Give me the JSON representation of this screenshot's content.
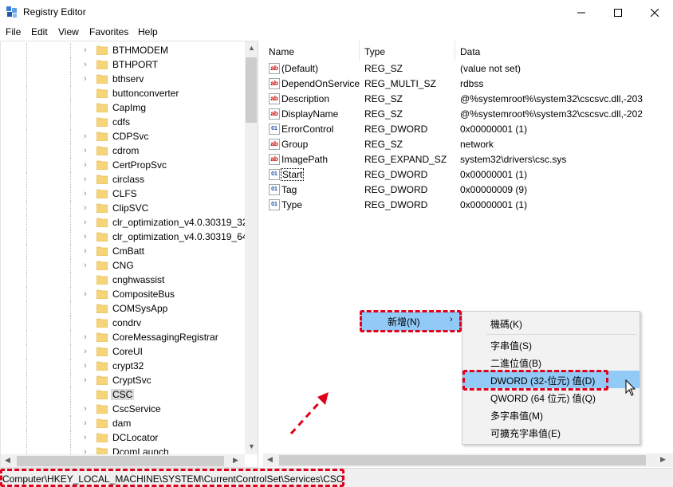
{
  "window": {
    "title": "Registry Editor",
    "controls": [
      "minimize",
      "maximize",
      "close"
    ]
  },
  "menu": [
    "File",
    "Edit",
    "View",
    "Favorites",
    "Help"
  ],
  "tree": {
    "items": [
      {
        "label": "BTHMODEM",
        "expandable": true
      },
      {
        "label": "BTHPORT",
        "expandable": true
      },
      {
        "label": "bthserv",
        "expandable": true
      },
      {
        "label": "buttonconverter",
        "expandable": false
      },
      {
        "label": "CapImg",
        "expandable": false
      },
      {
        "label": "cdfs",
        "expandable": false
      },
      {
        "label": "CDPSvc",
        "expandable": true
      },
      {
        "label": "cdrom",
        "expandable": true
      },
      {
        "label": "CertPropSvc",
        "expandable": true
      },
      {
        "label": "circlass",
        "expandable": true
      },
      {
        "label": "CLFS",
        "expandable": true
      },
      {
        "label": "ClipSVC",
        "expandable": true
      },
      {
        "label": "clr_optimization_v4.0.30319_32",
        "expandable": true
      },
      {
        "label": "clr_optimization_v4.0.30319_64",
        "expandable": true
      },
      {
        "label": "CmBatt",
        "expandable": true
      },
      {
        "label": "CNG",
        "expandable": true
      },
      {
        "label": "cnghwassist",
        "expandable": false
      },
      {
        "label": "CompositeBus",
        "expandable": true
      },
      {
        "label": "COMSysApp",
        "expandable": false
      },
      {
        "label": "condrv",
        "expandable": false
      },
      {
        "label": "CoreMessagingRegistrar",
        "expandable": true
      },
      {
        "label": "CoreUI",
        "expandable": true
      },
      {
        "label": "crypt32",
        "expandable": true
      },
      {
        "label": "CryptSvc",
        "expandable": true
      },
      {
        "label": "CSC",
        "expandable": false,
        "selected": true
      },
      {
        "label": "CscService",
        "expandable": true
      },
      {
        "label": "dam",
        "expandable": true
      },
      {
        "label": "DCLocator",
        "expandable": true
      },
      {
        "label": "DcomLaunch",
        "expandable": true
      }
    ]
  },
  "columns": {
    "name": "Name",
    "type": "Type",
    "data": "Data"
  },
  "values": [
    {
      "icon": "string-value-icon",
      "glyph": "ab",
      "name": "(Default)",
      "type": "REG_SZ",
      "data": "(value not set)"
    },
    {
      "icon": "string-value-icon",
      "glyph": "ab",
      "name": "DependOnService",
      "type": "REG_MULTI_SZ",
      "data": "rdbss"
    },
    {
      "icon": "string-value-icon",
      "glyph": "ab",
      "name": "Description",
      "type": "REG_SZ",
      "data": "@%systemroot%\\system32\\cscsvc.dll,-203"
    },
    {
      "icon": "string-value-icon",
      "glyph": "ab",
      "name": "DisplayName",
      "type": "REG_SZ",
      "data": "@%systemroot%\\system32\\cscsvc.dll,-202"
    },
    {
      "icon": "binary-value-icon",
      "glyph": "01",
      "name": "ErrorControl",
      "type": "REG_DWORD",
      "data": "0x00000001 (1)"
    },
    {
      "icon": "string-value-icon",
      "glyph": "ab",
      "name": "Group",
      "type": "REG_SZ",
      "data": "network"
    },
    {
      "icon": "string-value-icon",
      "glyph": "ab",
      "name": "ImagePath",
      "type": "REG_EXPAND_SZ",
      "data": "system32\\drivers\\csc.sys"
    },
    {
      "icon": "binary-value-icon",
      "glyph": "01",
      "name": "Start",
      "type": "REG_DWORD",
      "data": "0x00000001 (1)",
      "focused": true
    },
    {
      "icon": "binary-value-icon",
      "glyph": "01",
      "name": "Tag",
      "type": "REG_DWORD",
      "data": "0x00000009 (9)"
    },
    {
      "icon": "binary-value-icon",
      "glyph": "01",
      "name": "Type",
      "type": "REG_DWORD",
      "data": "0x00000001 (1)"
    }
  ],
  "context_menu": {
    "new_label": "新增(N)",
    "submenu": [
      {
        "label": "機碼(K)"
      },
      {
        "separator": true
      },
      {
        "label": "字串值(S)"
      },
      {
        "label": "二進位值(B)"
      },
      {
        "label": "DWORD (32-位元) 值(D)",
        "highlighted": true
      },
      {
        "label": "QWORD (64 位元) 值(Q)"
      },
      {
        "label": "多字串值(M)"
      },
      {
        "label": "可擴充字串值(E)"
      }
    ]
  },
  "status": {
    "path": "Computer\\HKEY_LOCAL_MACHINE\\SYSTEM\\CurrentControlSet\\Services\\CSC"
  },
  "annotation_color": "#e0001b",
  "highlight_color": "#91c9f7"
}
